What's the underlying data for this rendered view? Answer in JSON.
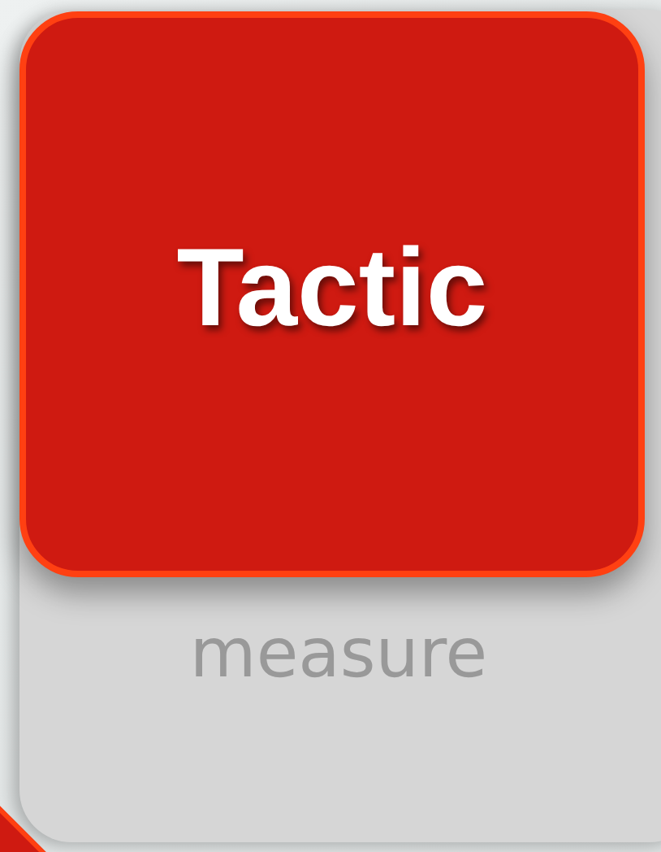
{
  "tile": {
    "title": "Tactic",
    "subtitle": "measure"
  }
}
